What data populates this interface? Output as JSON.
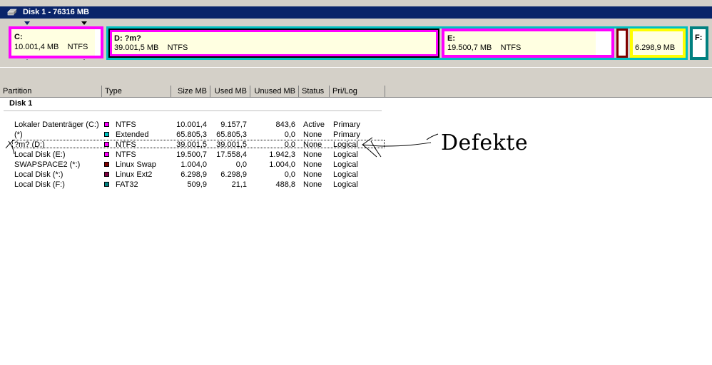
{
  "window": {
    "title": "Disk 1 - 76316 MB"
  },
  "map": {
    "partitions": [
      {
        "id": "c",
        "label": "C:",
        "size": "10.001,4 MB",
        "fs": "NTFS",
        "border": "#ff00ff"
      },
      {
        "id": "d",
        "label": "D:  ?m?",
        "size": "39.001,5 MB",
        "fs": "NTFS",
        "border": "#ff00ff"
      },
      {
        "id": "e",
        "label": "E:",
        "size": "19.500,7 MB",
        "fs": "NTFS",
        "border": "#ff00ff"
      },
      {
        "id": "swap",
        "label": "",
        "size": "",
        "fs": "",
        "border": "#800000"
      },
      {
        "id": "ext2",
        "label": "",
        "size": "6.298,9 MB",
        "fs": "",
        "border": "#ffff00"
      },
      {
        "id": "f",
        "label": "F:",
        "size": "",
        "fs": "",
        "border": "#008080"
      }
    ],
    "extended_color": "#00c0c0"
  },
  "table": {
    "columns": [
      "Partition",
      "Type",
      "Size MB",
      "Used MB",
      "Unused MB",
      "Status",
      "Pri/Log"
    ],
    "disk_label": "Disk 1",
    "rows": [
      {
        "partition": "Lokaler Datenträger (C:)",
        "color": "#ff00ff",
        "type": "NTFS",
        "size": "10.001,4",
        "used": "9.157,7",
        "unused": "843,6",
        "status": "Active",
        "prilog": "Primary"
      },
      {
        "partition": "(*)",
        "color": "#00c0c0",
        "type": "Extended",
        "size": "65.805,3",
        "used": "65.805,3",
        "unused": "0,0",
        "status": "None",
        "prilog": "Primary"
      },
      {
        "partition": "?m? (D:)",
        "color": "#ff00ff",
        "type": "NTFS",
        "size": "39.001,5",
        "used": "39.001,5",
        "unused": "0,0",
        "status": "None",
        "prilog": "Logical"
      },
      {
        "partition": "Local Disk (E:)",
        "color": "#ff00ff",
        "type": "NTFS",
        "size": "19.500,7",
        "used": "17.558,4",
        "unused": "1.942,3",
        "status": "None",
        "prilog": "Logical"
      },
      {
        "partition": "SWAPSPACE2 (*:)",
        "color": "#800000",
        "type": "Linux Swap",
        "size": "1.004,0",
        "used": "0,0",
        "unused": "1.004,0",
        "status": "None",
        "prilog": "Logical"
      },
      {
        "partition": "Local Disk (*:)",
        "color": "#800040",
        "type": "Linux Ext2",
        "size": "6.298,9",
        "used": "6.298,9",
        "unused": "0,0",
        "status": "None",
        "prilog": "Logical"
      },
      {
        "partition": "Local Disk (F:)",
        "color": "#008080",
        "type": "FAT32",
        "size": "509,9",
        "used": "21,1",
        "unused": "488,8",
        "status": "None",
        "prilog": "Logical"
      }
    ]
  },
  "annotation": {
    "text": "Defekte"
  },
  "icons": {
    "disk": "disk-icon",
    "swatch": "color-swatch-icon"
  }
}
